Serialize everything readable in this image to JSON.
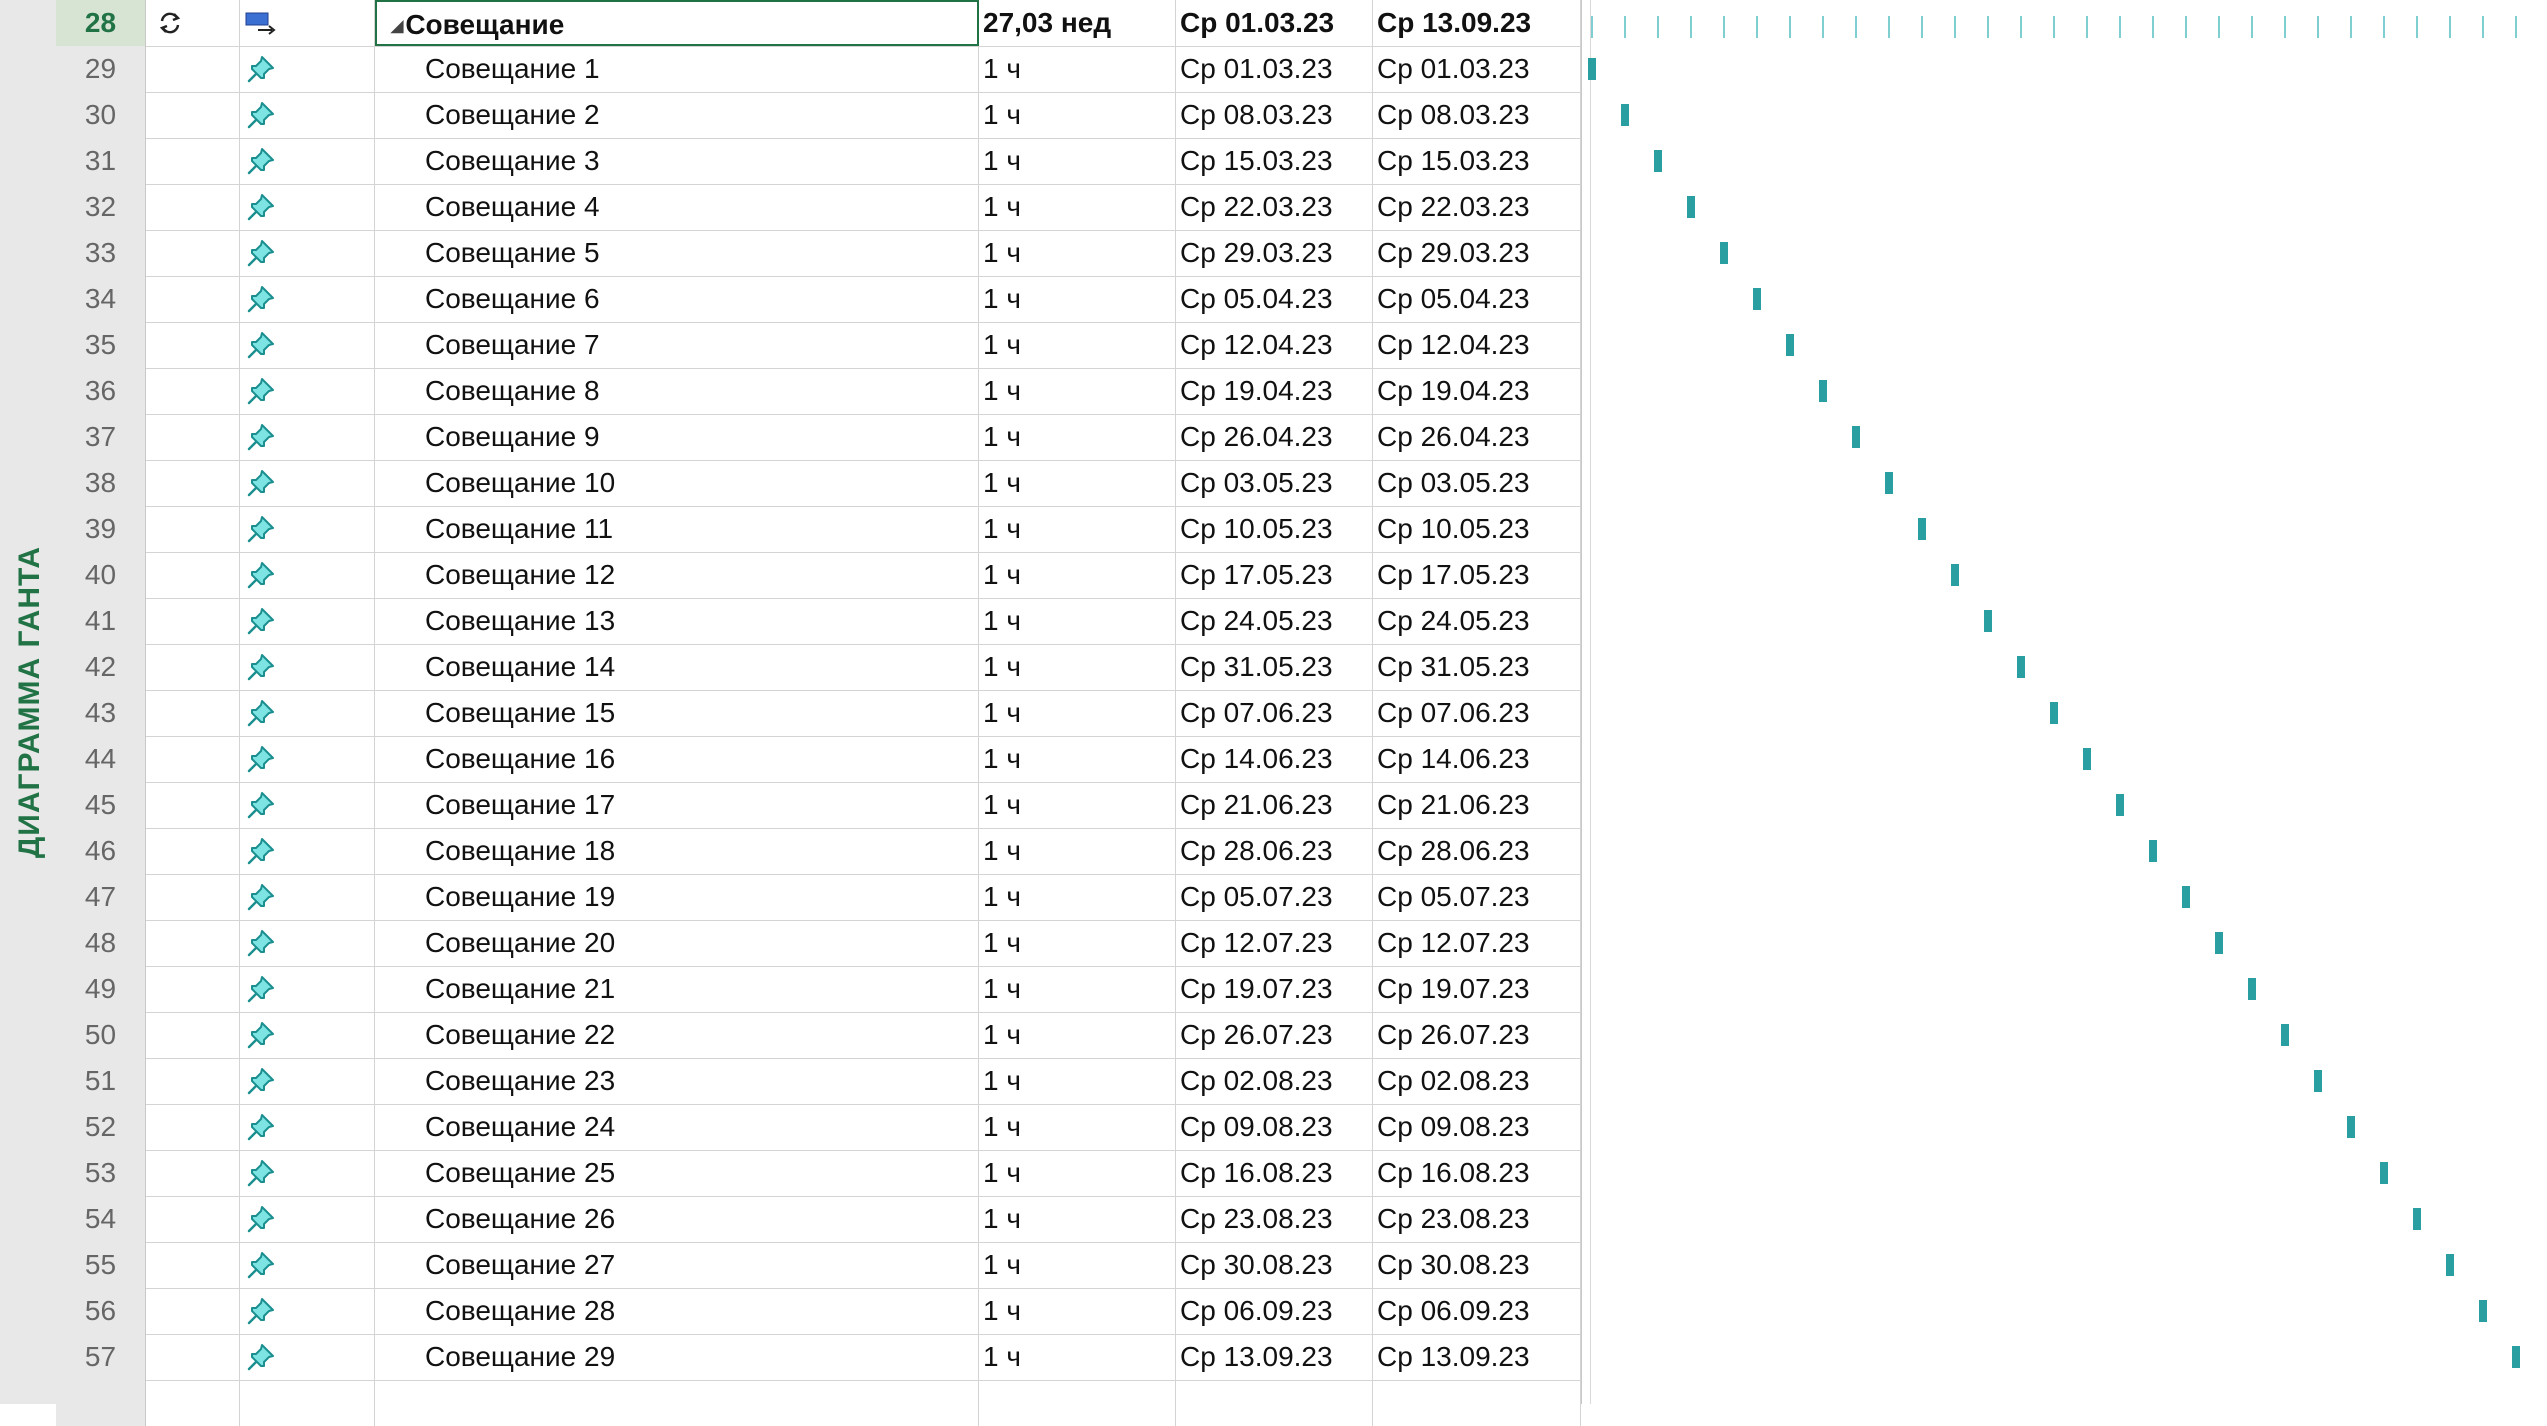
{
  "view_label": "ДИАГРАММА ГАНТА",
  "colors": {
    "accent_green": "#217346",
    "gantt_bar": "#2a9fa2",
    "pin": "#2aa8a8"
  },
  "summary": {
    "id": "28",
    "indicator_icon": "recurring-task-icon",
    "mode_icon": "auto-scheduled-icon",
    "name": "Совещание",
    "duration": "27,03 нед",
    "start": "Ср 01.03.23",
    "finish": "Ср 13.09.23"
  },
  "tasks": [
    {
      "id": "29",
      "name": "Совещание 1",
      "duration": "1 ч",
      "start": "Ср 01.03.23",
      "finish": "Ср 01.03.23"
    },
    {
      "id": "30",
      "name": "Совещание 2",
      "duration": "1 ч",
      "start": "Ср 08.03.23",
      "finish": "Ср 08.03.23"
    },
    {
      "id": "31",
      "name": "Совещание 3",
      "duration": "1 ч",
      "start": "Ср 15.03.23",
      "finish": "Ср 15.03.23"
    },
    {
      "id": "32",
      "name": "Совещание 4",
      "duration": "1 ч",
      "start": "Ср 22.03.23",
      "finish": "Ср 22.03.23"
    },
    {
      "id": "33",
      "name": "Совещание 5",
      "duration": "1 ч",
      "start": "Ср 29.03.23",
      "finish": "Ср 29.03.23"
    },
    {
      "id": "34",
      "name": "Совещание 6",
      "duration": "1 ч",
      "start": "Ср 05.04.23",
      "finish": "Ср 05.04.23"
    },
    {
      "id": "35",
      "name": "Совещание 7",
      "duration": "1 ч",
      "start": "Ср 12.04.23",
      "finish": "Ср 12.04.23"
    },
    {
      "id": "36",
      "name": "Совещание 8",
      "duration": "1 ч",
      "start": "Ср 19.04.23",
      "finish": "Ср 19.04.23"
    },
    {
      "id": "37",
      "name": "Совещание 9",
      "duration": "1 ч",
      "start": "Ср 26.04.23",
      "finish": "Ср 26.04.23"
    },
    {
      "id": "38",
      "name": "Совещание 10",
      "duration": "1 ч",
      "start": "Ср 03.05.23",
      "finish": "Ср 03.05.23"
    },
    {
      "id": "39",
      "name": "Совещание 11",
      "duration": "1 ч",
      "start": "Ср 10.05.23",
      "finish": "Ср 10.05.23"
    },
    {
      "id": "40",
      "name": "Совещание 12",
      "duration": "1 ч",
      "start": "Ср 17.05.23",
      "finish": "Ср 17.05.23"
    },
    {
      "id": "41",
      "name": "Совещание 13",
      "duration": "1 ч",
      "start": "Ср 24.05.23",
      "finish": "Ср 24.05.23"
    },
    {
      "id": "42",
      "name": "Совещание 14",
      "duration": "1 ч",
      "start": "Ср 31.05.23",
      "finish": "Ср 31.05.23"
    },
    {
      "id": "43",
      "name": "Совещание 15",
      "duration": "1 ч",
      "start": "Ср 07.06.23",
      "finish": "Ср 07.06.23"
    },
    {
      "id": "44",
      "name": "Совещание 16",
      "duration": "1 ч",
      "start": "Ср 14.06.23",
      "finish": "Ср 14.06.23"
    },
    {
      "id": "45",
      "name": "Совещание 17",
      "duration": "1 ч",
      "start": "Ср 21.06.23",
      "finish": "Ср 21.06.23"
    },
    {
      "id": "46",
      "name": "Совещание 18",
      "duration": "1 ч",
      "start": "Ср 28.06.23",
      "finish": "Ср 28.06.23"
    },
    {
      "id": "47",
      "name": "Совещание 19",
      "duration": "1 ч",
      "start": "Ср 05.07.23",
      "finish": "Ср 05.07.23"
    },
    {
      "id": "48",
      "name": "Совещание 20",
      "duration": "1 ч",
      "start": "Ср 12.07.23",
      "finish": "Ср 12.07.23"
    },
    {
      "id": "49",
      "name": "Совещание 21",
      "duration": "1 ч",
      "start": "Ср 19.07.23",
      "finish": "Ср 19.07.23"
    },
    {
      "id": "50",
      "name": "Совещание 22",
      "duration": "1 ч",
      "start": "Ср 26.07.23",
      "finish": "Ср 26.07.23"
    },
    {
      "id": "51",
      "name": "Совещание 23",
      "duration": "1 ч",
      "start": "Ср 02.08.23",
      "finish": "Ср 02.08.23"
    },
    {
      "id": "52",
      "name": "Совещание 24",
      "duration": "1 ч",
      "start": "Ср 09.08.23",
      "finish": "Ср 09.08.23"
    },
    {
      "id": "53",
      "name": "Совещание 25",
      "duration": "1 ч",
      "start": "Ср 16.08.23",
      "finish": "Ср 16.08.23"
    },
    {
      "id": "54",
      "name": "Совещание 26",
      "duration": "1 ч",
      "start": "Ср 23.08.23",
      "finish": "Ср 23.08.23"
    },
    {
      "id": "55",
      "name": "Совещание 27",
      "duration": "1 ч",
      "start": "Ср 30.08.23",
      "finish": "Ср 30.08.23"
    },
    {
      "id": "56",
      "name": "Совещание 28",
      "duration": "1 ч",
      "start": "Ср 06.09.23",
      "finish": "Ср 06.09.23"
    },
    {
      "id": "57",
      "name": "Совещание 29",
      "duration": "1 ч",
      "start": "Ср 13.09.23",
      "finish": "Ср 13.09.23"
    }
  ],
  "task_mode_icon": "manually-scheduled-pin-icon"
}
